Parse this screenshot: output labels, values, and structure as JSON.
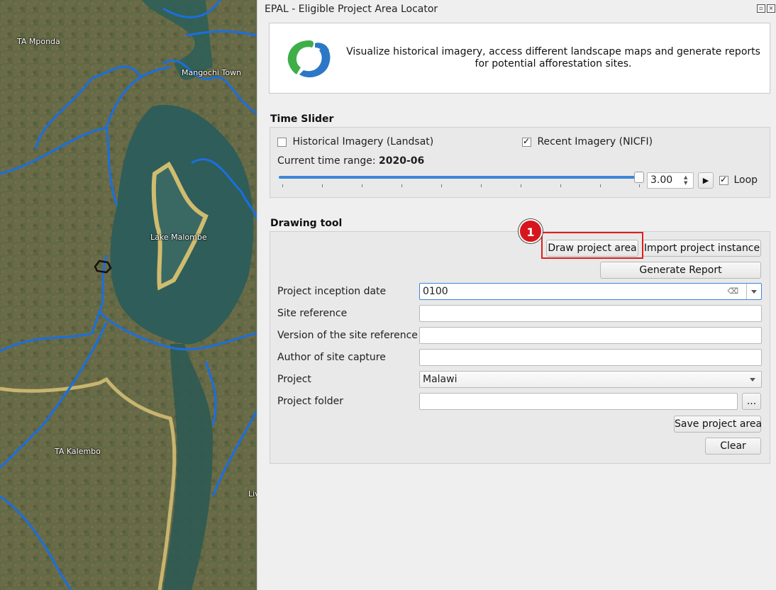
{
  "map": {
    "labels": {
      "ta_mponda": "TA Mponda",
      "mangochi_town": "Mangochi Town",
      "lake_malombe": "Lake Malombe",
      "ta_kalembo": "TA Kalembo",
      "edge_label": "Liv"
    },
    "colors": {
      "boundary": "#1a6fe0",
      "project_outline": "#e2c36a",
      "water": "#2e5e58"
    }
  },
  "panel": {
    "title": "EPAL - Eligible Project Area Locator",
    "banner_text": "Visualize historical imagery, access different landscape maps and generate reports for potential afforestation sites.",
    "logo": {
      "icon": "epal-logo-icon",
      "colors": [
        "#3fae49",
        "#2c78c6"
      ]
    },
    "time_slider": {
      "title": "Time Slider",
      "historical_label": "Historical Imagery (Landsat)",
      "historical_checked": false,
      "recent_label": "Recent Imagery (NICFI)",
      "recent_checked": true,
      "range_prefix": "Current time range: ",
      "range_value": "2020-06",
      "slider_position": 1.0,
      "speed_value": "3.00",
      "play_icon": "play-icon",
      "loop_label": "Loop",
      "loop_checked": true
    },
    "drawing_tool": {
      "title": "Drawing tool",
      "draw_button": "Draw project area",
      "import_button": "Import project instance",
      "generate_button": "Generate Report",
      "fields": {
        "inception_label": "Project inception date",
        "inception_value": "0100",
        "site_ref_label": "Site reference",
        "site_ref_value": "",
        "version_label": "Version of the site reference",
        "version_value": "",
        "author_label": "Author of site capture",
        "author_value": "",
        "project_label": "Project",
        "project_value": "Malawi",
        "folder_label": "Project folder",
        "folder_value": "",
        "browse_label": "..."
      },
      "save_button": "Save project area",
      "clear_button": "Clear"
    },
    "annotation": {
      "badge_number": "1",
      "color": "#e01d1d"
    }
  }
}
